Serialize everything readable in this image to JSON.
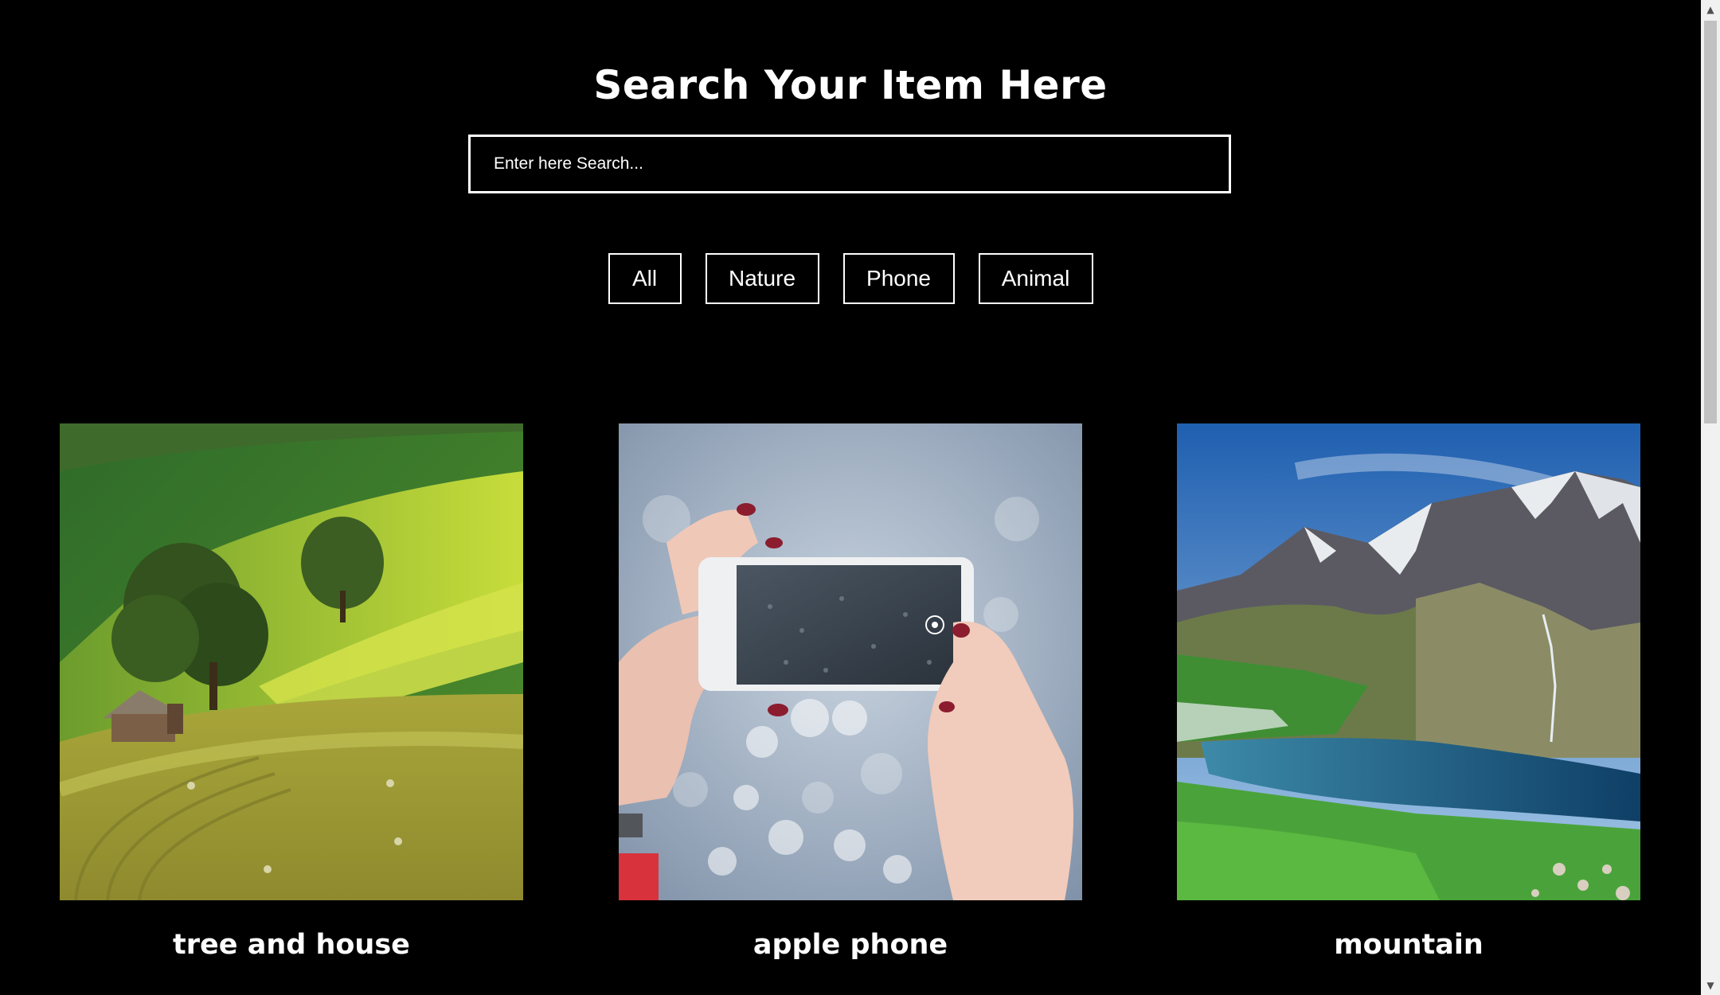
{
  "header": {
    "title": "Search Your Item Here"
  },
  "search": {
    "placeholder": "Enter here Search...",
    "value": ""
  },
  "filters": [
    {
      "label": "All"
    },
    {
      "label": "Nature"
    },
    {
      "label": "Phone"
    },
    {
      "label": "Animal"
    }
  ],
  "cards": [
    {
      "caption": "tree and house",
      "image": "green-hills-tree-house-photo"
    },
    {
      "caption": "apple phone",
      "image": "hands-holding-phone-photo"
    },
    {
      "caption": "mountain",
      "image": "mountain-lake-photo"
    }
  ],
  "colors": {
    "background": "#000000",
    "text": "#ffffff",
    "border": "#ffffff"
  }
}
